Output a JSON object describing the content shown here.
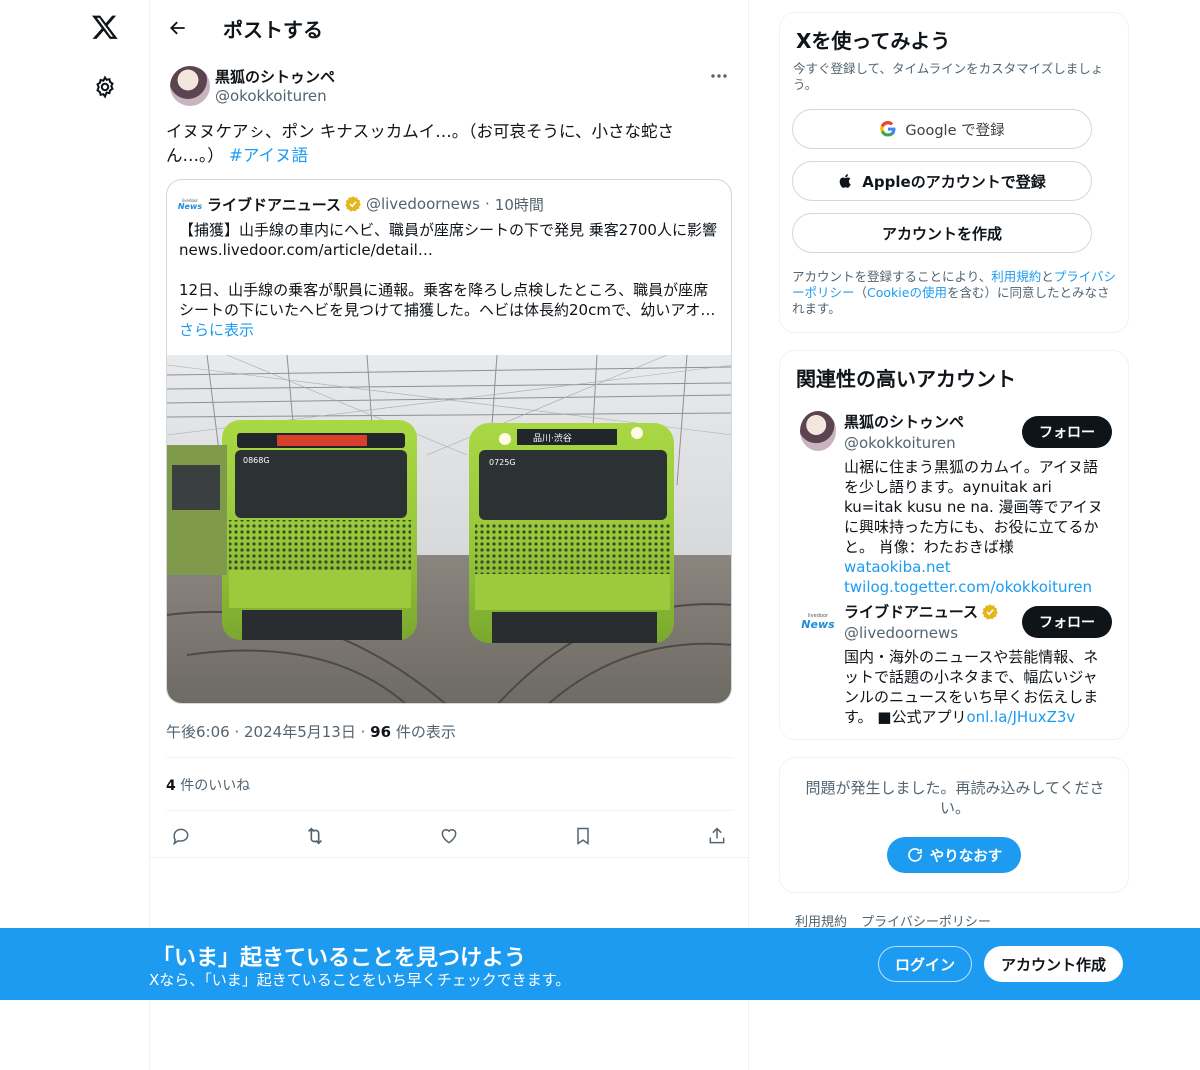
{
  "nav": {
    "logo_icon": "x-logo-icon",
    "settings_icon": "gear-icon"
  },
  "header": {
    "title": "ポストする",
    "back_icon": "arrow-left-icon"
  },
  "post": {
    "author_name": "黒狐のシトゥンペ",
    "author_handle": "@okokkoituren",
    "text": "イヌヌケアㇱ、ポン キナスッカムイ…。（お可哀そうに、小さな蛇さん…。）",
    "hashtag": "#アイヌ語",
    "quote": {
      "logo_top": "livedoor",
      "logo_bottom": "News",
      "name": "ライブドアニュース",
      "handle": "@livedoornews",
      "time": "10時間",
      "line1": "【捕獲】山手線の車内にヘビ、職員が座席シートの下で発見 乗客2700人に影響",
      "line2": "news.livedoor.com/article/detail…",
      "body": "12日、山手線の乗客が駅員に通報。乗客を降ろし点検したところ、職員が座席シートの下にいたヘビを見つけて捕獲した。ヘビは体長約20cmで、幼いアオ…",
      "show_more": "さらに表示",
      "train_left_code": "0868G",
      "train_right_code": "0725G",
      "train_right_dest": "品川·渋谷"
    },
    "meta_time": "午後6:06",
    "meta_date": "2024年5月13日",
    "meta_views_count": "96",
    "meta_views_label": "件の表示",
    "likes_count": "4",
    "likes_label": "件のいいね"
  },
  "signup": {
    "title": "Xを使ってみよう",
    "subtitle": "今すぐ登録して、タイムラインをカスタマイズしましょう。",
    "google_label": "Google で登録",
    "apple_label": "Appleのアカウントで登録",
    "create_label": "アカウントを作成",
    "terms_1": "アカウントを登録することにより、",
    "terms_link1": "利用規約",
    "terms_2": "と",
    "terms_link2": "プライバシーポリシー",
    "terms_3": "（",
    "terms_link3": "Cookieの使用",
    "terms_4": "を含む）に同意したとみなされます。"
  },
  "related": {
    "title": "関連性の高いアカウント",
    "accounts": [
      {
        "name": "黒狐のシトゥンペ",
        "handle": "@okokkoituren",
        "bio": "山裾に住まう黒狐のカムイ。アイヌ語を少し語ります。aynuitak ari ku=itak kusu ne na. 漫画等でアイヌに興味持った方にも、お役に立てるかと。 肖像：わたおきば様 ",
        "link1": "wataokiba.net",
        "link2": "twilog.togetter.com/okokkoituren",
        "follow": "フォロー"
      },
      {
        "name": "ライブドアニュース",
        "handle": "@livedoornews",
        "bio": "国内・海外のニュースや芸能情報、ネットで話題の小ネタまで、幅広いジャンルのニュースをいち早くお伝えします。 ■公式アプリ",
        "link1": "onl.la/JHuxZ3v",
        "follow": "フォロー",
        "logo_top": "livedoor",
        "logo_bottom": "News"
      }
    ]
  },
  "error": {
    "text": "問題が発生しました。再読み込みしてください。",
    "retry": "やりなおす"
  },
  "footer": {
    "terms": "利用規約",
    "privacy": "プライバシーポリシー"
  },
  "banner": {
    "title": "「いま」起きていることを見つけよう",
    "subtitle": "Xなら、「いま」起きていることをいち早くチェックできます。",
    "login": "ログイン",
    "create": "アカウント作成"
  },
  "colors": {
    "accent": "#1d9bf0",
    "text": "#0f1419",
    "muted": "#536471",
    "verified": "#e2b719",
    "train_green": "#9fd23c"
  }
}
